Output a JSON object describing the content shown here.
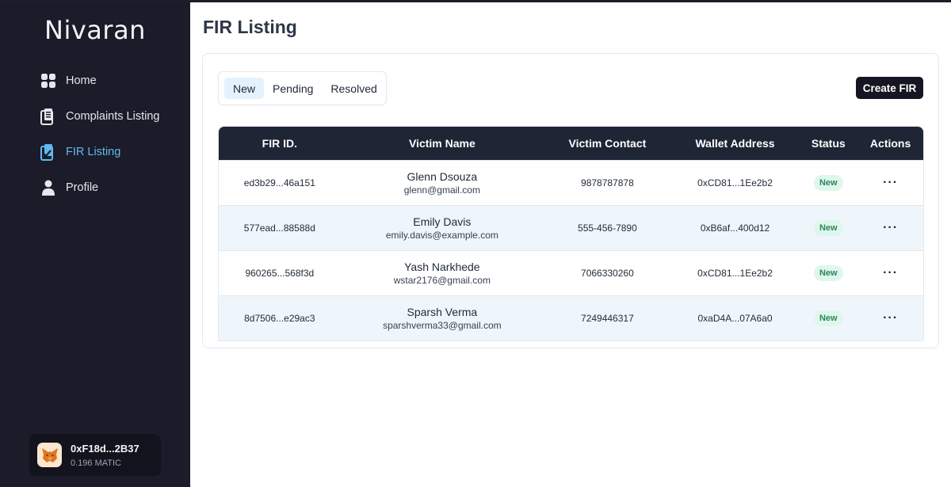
{
  "sidebar": {
    "brand": "Nivaran",
    "items": [
      {
        "label": "Home",
        "icon": "grid-icon",
        "active": false
      },
      {
        "label": "Complaints Listing",
        "icon": "clipboard-list-icon",
        "active": false
      },
      {
        "label": "FIR Listing",
        "icon": "clipboard-check-icon",
        "active": true
      },
      {
        "label": "Profile",
        "icon": "user-icon",
        "active": false
      }
    ],
    "wallet": {
      "address": "0xF18d...2B37",
      "balance": "0.196 MATIC",
      "icon": "metamask-fox-icon"
    }
  },
  "main": {
    "title": "FIR Listing",
    "tabs": [
      {
        "label": "New",
        "active": true
      },
      {
        "label": "Pending",
        "active": false
      },
      {
        "label": "Resolved",
        "active": false
      }
    ],
    "create_button": "Create FIR"
  },
  "table": {
    "headers": [
      "FIR ID.",
      "Victim Name",
      "Victim Contact",
      "Wallet Address",
      "Status",
      "Actions"
    ],
    "rows": [
      {
        "id": "ed3b29...46a151",
        "name": "Glenn Dsouza",
        "email": "glenn@gmail.com",
        "contact": "9878787878",
        "wallet": "0xCD81...1Ee2b2",
        "status": "New",
        "actions": "···"
      },
      {
        "id": "577ead...88588d",
        "name": "Emily Davis",
        "email": "emily.davis@example.com",
        "contact": "555-456-7890",
        "wallet": "0xB6af...400d12",
        "status": "New",
        "actions": "···"
      },
      {
        "id": "960265...568f3d",
        "name": "Yash Narkhede",
        "email": "wstar2176@gmail.com",
        "contact": "7066330260",
        "wallet": "0xCD81...1Ee2b2",
        "status": "New",
        "actions": "···"
      },
      {
        "id": "8d7506...e29ac3",
        "name": "Sparsh Verma",
        "email": "sparshverma33@gmail.com",
        "contact": "7249446317",
        "wallet": "0xaD4A...07A6a0",
        "status": "New",
        "actions": "···"
      }
    ]
  },
  "colors": {
    "sidebar_bg": "#1b1b29",
    "accent": "#60b8f0",
    "header_bg": "#1e2535",
    "badge_bg": "#def7ec",
    "badge_text": "#2f855a"
  }
}
